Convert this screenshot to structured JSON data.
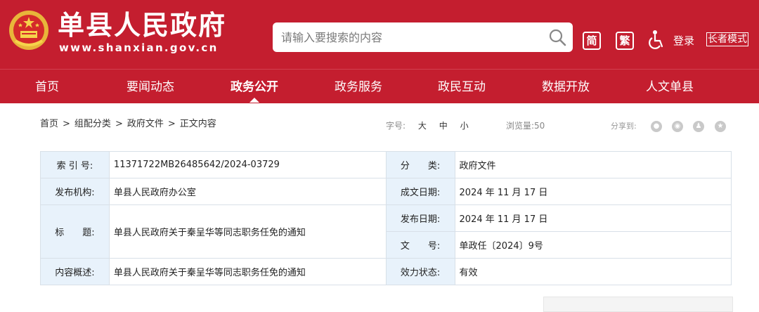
{
  "header": {
    "site_name": "单县人民政府",
    "site_url": "www.shanxian.gov.cn",
    "search_placeholder": "请输入要搜索的内容",
    "simplified_label": "简",
    "traditional_label": "繁",
    "login_label": "登录",
    "elder_mode_label": "长者模式",
    "brand_color": "#c41e2f"
  },
  "nav": {
    "items": [
      {
        "label": "首页"
      },
      {
        "label": "要闻动态"
      },
      {
        "label": "政务公开",
        "active": true
      },
      {
        "label": "政务服务"
      },
      {
        "label": "政民互动"
      },
      {
        "label": "数据开放"
      },
      {
        "label": "人文单县"
      }
    ]
  },
  "breadcrumb": [
    "首页",
    "组配分类",
    "政府文件",
    "正文内容"
  ],
  "breadcrumb_separator": ">",
  "toolbar": {
    "font_size_label": "字号:",
    "font_large": "大",
    "font_medium": "中",
    "font_small": "小",
    "views_label": "浏览量:",
    "views_count": "50",
    "share_label": "分享到:",
    "share_icons": [
      "wechat-icon",
      "weibo-icon",
      "qq-icon",
      "qzone-icon"
    ]
  },
  "meta": {
    "index_label": "索 引 号:",
    "index_value": "11371722MB26485642/2024-03729",
    "category_label": "分　　类:",
    "category_value": "政府文件",
    "publisher_label": "发布机构:",
    "publisher_value": "单县人民政府办公室",
    "created_label": "成文日期:",
    "created_value": "2024 年 11 月 17 日",
    "title_label": "标　　题:",
    "title_value": "单县人民政府关于秦呈华等同志职务任免的通知",
    "published_label": "发布日期:",
    "published_value": "2024 年 11 月 17 日",
    "doc_no_label": "文　　号:",
    "doc_no_value": "单政任〔2024〕9号",
    "summary_label": "内容概述:",
    "summary_value": "单县人民政府关于秦呈华等同志职务任免的通知",
    "status_label": "效力状态:",
    "status_value": "有效"
  }
}
